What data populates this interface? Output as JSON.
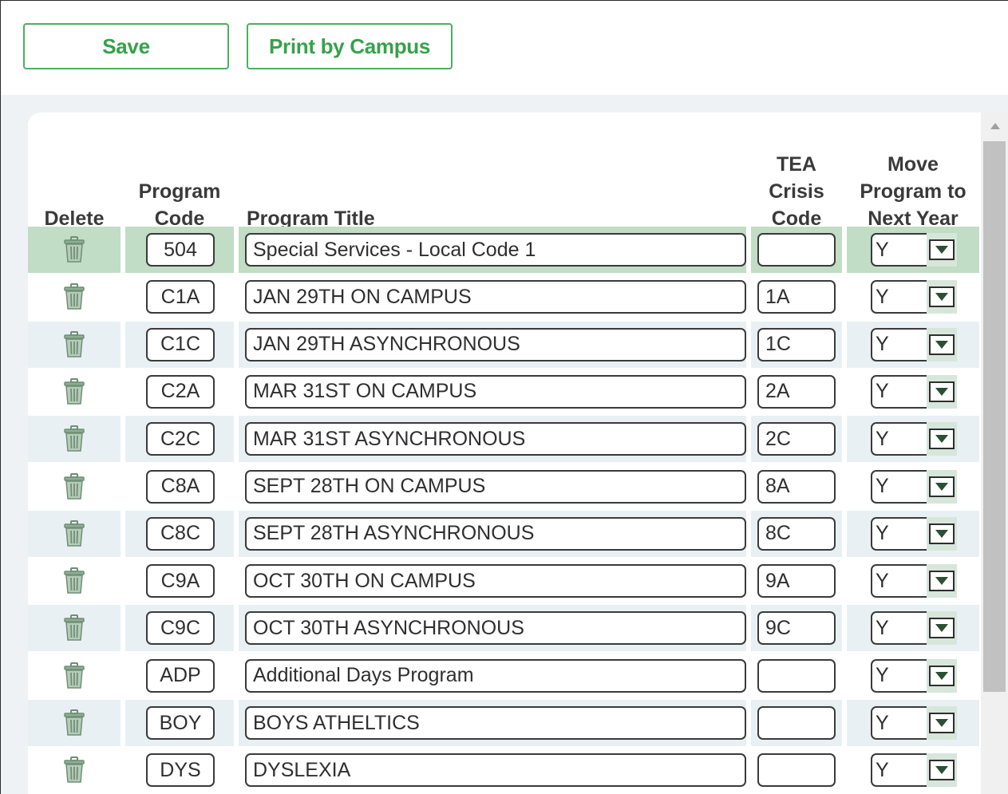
{
  "toolbar": {
    "save_label": "Save",
    "print_label": "Print by Campus"
  },
  "columns": {
    "delete": "Delete",
    "program_code": "Program\nCode",
    "program_title": "Program Title",
    "tea_crisis_code": "TEA\nCrisis\nCode",
    "move_program": "Move\nProgram to\nNext Year"
  },
  "rows": [
    {
      "code": "504",
      "title": "Special Services - Local Code 1",
      "tea": "",
      "move": "Y",
      "selected": true
    },
    {
      "code": "C1A",
      "title": "JAN 29TH ON CAMPUS",
      "tea": "1A",
      "move": "Y"
    },
    {
      "code": "C1C",
      "title": "JAN 29TH ASYNCHRONOUS",
      "tea": "1C",
      "move": "Y"
    },
    {
      "code": "C2A",
      "title": "MAR 31ST ON CAMPUS",
      "tea": "2A",
      "move": "Y"
    },
    {
      "code": "C2C",
      "title": "MAR 31ST ASYNCHRONOUS",
      "tea": "2C",
      "move": "Y"
    },
    {
      "code": "C8A",
      "title": "SEPT 28TH ON CAMPUS",
      "tea": "8A",
      "move": "Y"
    },
    {
      "code": "C8C",
      "title": "SEPT 28TH ASYNCHRONOUS",
      "tea": "8C",
      "move": "Y"
    },
    {
      "code": "C9A",
      "title": "OCT 30TH ON CAMPUS",
      "tea": "9A",
      "move": "Y"
    },
    {
      "code": "C9C",
      "title": "OCT 30TH ASYNCHRONOUS",
      "tea": "9C",
      "move": "Y"
    },
    {
      "code": "ADP",
      "title": "Additional Days Program",
      "tea": "",
      "move": "Y"
    },
    {
      "code": "BOY",
      "title": "BOYS ATHELTICS",
      "tea": "",
      "move": "Y"
    },
    {
      "code": "DYS",
      "title": "DYSLEXIA",
      "tea": "",
      "move": "Y"
    }
  ],
  "icons": {
    "delete": "trash-icon",
    "dropdown": "dropdown-arrow-icon",
    "scroll_up": "scroll-up-arrow-icon"
  },
  "colors": {
    "accent_green": "#35a24a",
    "selected_row": "#c1ddc5",
    "alt_row": "#e9f0f4",
    "grid_background": "#eef2f5"
  }
}
